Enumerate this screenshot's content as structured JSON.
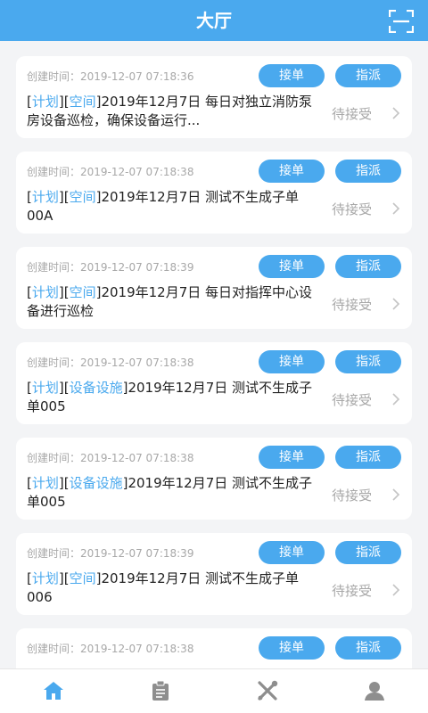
{
  "header": {
    "title": "大厅",
    "scan_icon": "scan-icon"
  },
  "cards": [
    {
      "created": "创建时间：2019-12-07 07:18:36",
      "accept": "接单",
      "assign": "指派",
      "tag1": "计划",
      "tag2": "空间",
      "text": "2019年12月7日 每日对独立消防泵房设备巡检，确保设备运行...",
      "status": "待接受"
    },
    {
      "created": "创建时间：2019-12-07 07:18:38",
      "accept": "接单",
      "assign": "指派",
      "tag1": "计划",
      "tag2": "空间",
      "text": "2019年12月7日 测试不生成子单00A",
      "status": "待接受"
    },
    {
      "created": "创建时间：2019-12-07 07:18:39",
      "accept": "接单",
      "assign": "指派",
      "tag1": "计划",
      "tag2": "空间",
      "text": "2019年12月7日 每日对指挥中心设备进行巡检",
      "status": "待接受"
    },
    {
      "created": "创建时间：2019-12-07 07:18:38",
      "accept": "接单",
      "assign": "指派",
      "tag1": "计划",
      "tag2": "设备设施",
      "text": "2019年12月7日 测试不生成子单005",
      "status": "待接受"
    },
    {
      "created": "创建时间：2019-12-07 07:18:38",
      "accept": "接单",
      "assign": "指派",
      "tag1": "计划",
      "tag2": "设备设施",
      "text": "2019年12月7日 测试不生成子单005",
      "status": "待接受"
    },
    {
      "created": "创建时间：2019-12-07 07:18:39",
      "accept": "接单",
      "assign": "指派",
      "tag1": "计划",
      "tag2": "空间",
      "text": "2019年12月7日 测试不生成子单006",
      "status": "待接受"
    },
    {
      "created": "创建时间：2019-12-07 07:18:38",
      "accept": "接单",
      "assign": "指派",
      "tag1": "",
      "tag2": "",
      "text": "",
      "status": ""
    }
  ],
  "tabbar": {
    "items": [
      "home-icon",
      "clipboard-icon",
      "tools-icon",
      "user-icon"
    ],
    "active": 0
  },
  "colors": {
    "accent": "#4aa9ee",
    "muted": "#a8a8a8",
    "bg": "#f3f4f6"
  }
}
